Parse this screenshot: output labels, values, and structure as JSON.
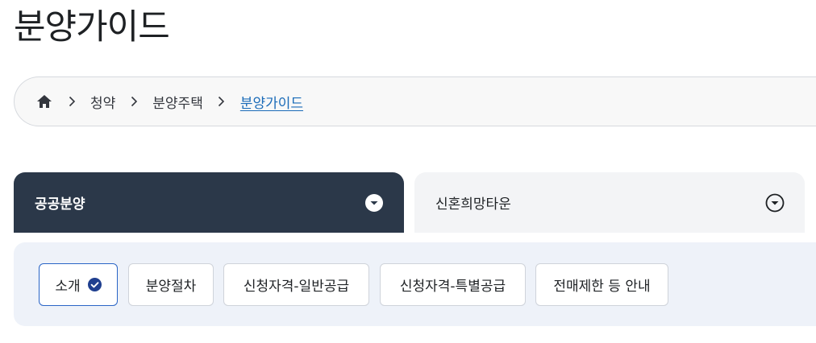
{
  "page": {
    "title": "분양가이드"
  },
  "breadcrumb": {
    "items": [
      {
        "label": "청약"
      },
      {
        "label": "분양주택"
      },
      {
        "label": "분양가이드"
      }
    ]
  },
  "tabs": [
    {
      "label": "공공분양",
      "active": true
    },
    {
      "label": "신혼희망타운",
      "active": false
    }
  ],
  "subtabs": [
    {
      "label": "소개",
      "selected": true
    },
    {
      "label": "분양절차",
      "selected": false
    },
    {
      "label": "신청자격-일반공급",
      "selected": false
    },
    {
      "label": "신청자격-특별공급",
      "selected": false
    },
    {
      "label": "전매제한 등 안내",
      "selected": false
    }
  ],
  "colors": {
    "active_tab_bg": "#2b3849",
    "link_blue": "#1a6bb8",
    "selected_chip_border": "#2a65c6",
    "subnav_bg": "#eef2f9"
  }
}
